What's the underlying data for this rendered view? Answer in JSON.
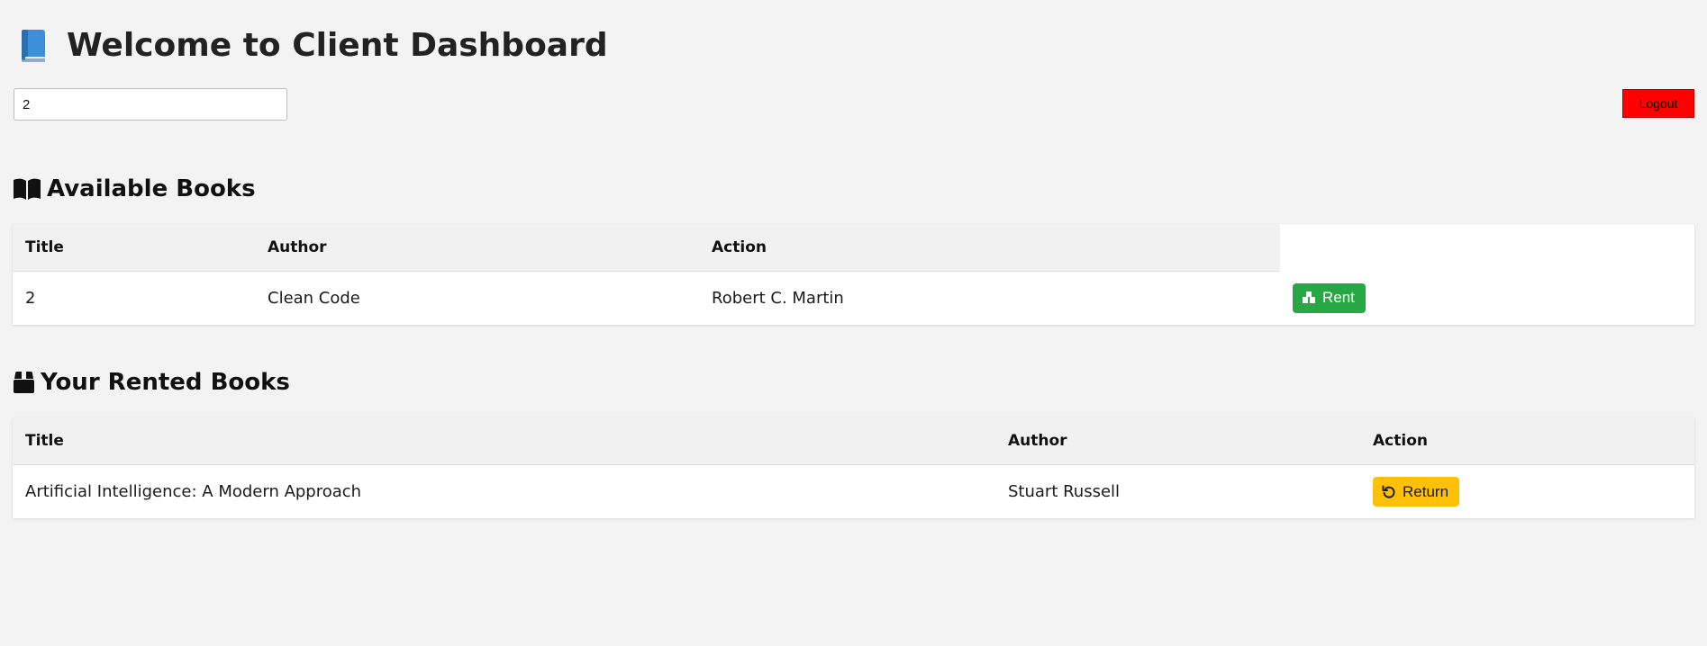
{
  "header": {
    "title": "Welcome to Client Dashboard"
  },
  "user_input": {
    "value": "2"
  },
  "logout": {
    "label": "Logout",
    "color": "#ff0000"
  },
  "available": {
    "title": "Available Books",
    "columns": [
      "Title",
      "Author",
      "Action"
    ],
    "rows": [
      {
        "cells": [
          "2",
          "Clean Code",
          "Robert C. Martin"
        ],
        "action": "Rent"
      }
    ]
  },
  "rented": {
    "title": "Your Rented Books",
    "columns": [
      "Title",
      "Author",
      "Action"
    ],
    "rows": [
      {
        "title": "Artificial Intelligence: A Modern Approach",
        "author": "Stuart Russell",
        "action": "Return"
      }
    ]
  },
  "colors": {
    "background": "#f3f3f3",
    "rent": "#28a745",
    "return": "#ffc107"
  }
}
